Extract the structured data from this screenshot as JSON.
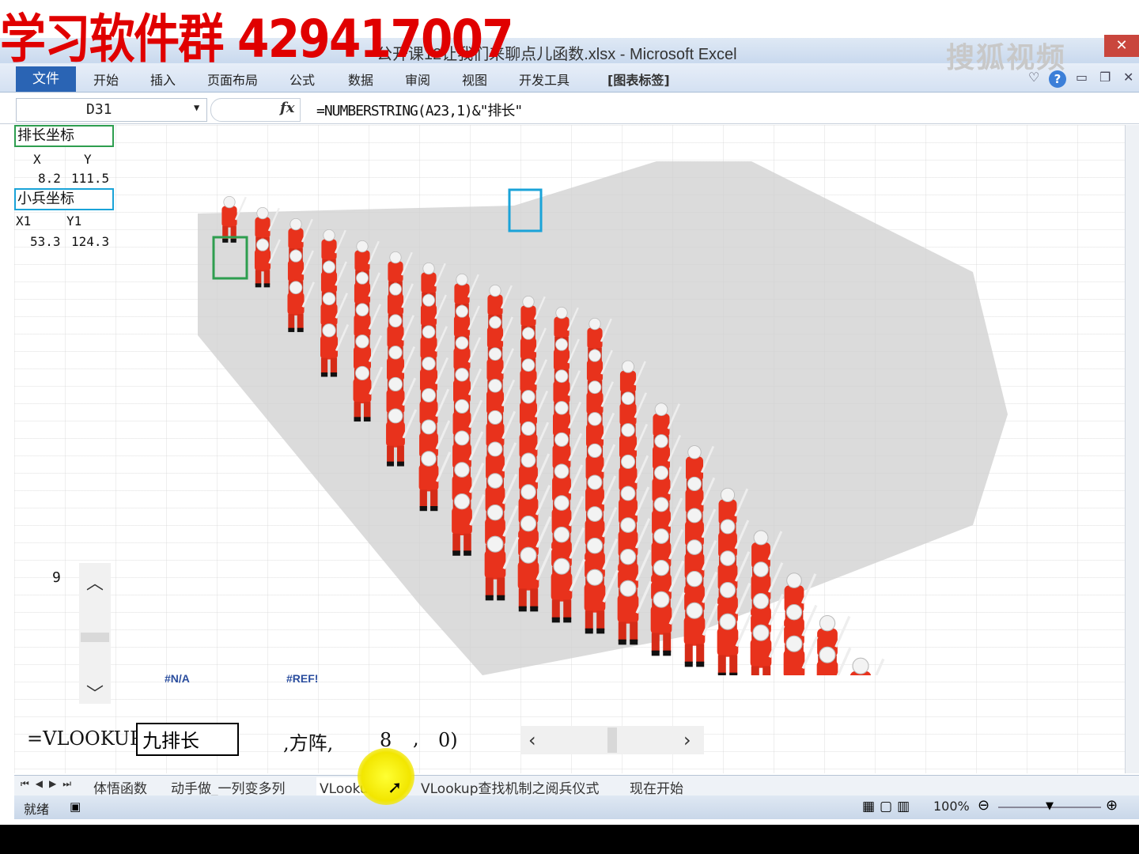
{
  "watermark": {
    "top_text": "学习软件群 429417007",
    "sohu": "搜狐视频"
  },
  "window": {
    "title": "公开课12让我们来聊点儿函数.xlsx - Microsoft Excel",
    "close": "✕"
  },
  "ribbon": {
    "file": "文件",
    "tabs": [
      "开始",
      "插入",
      "页面布局",
      "公式",
      "数据",
      "审阅",
      "视图",
      "开发工具"
    ],
    "context_tab": "[图表标签]"
  },
  "formula_bar": {
    "name_box": "D31",
    "fx": "fx",
    "formula": "=NUMBERSTRING(A23,1)&\"排长\""
  },
  "cells": {
    "platoon_label": "排长坐标",
    "x_header": "X",
    "y_header": "Y",
    "x_val": "8.2",
    "y_val": "111.5",
    "soldier_label": "小兵坐标",
    "x1_header": "X1",
    "y1_header": "Y1",
    "x1_val": "53.3",
    "y1_val": "124.3",
    "spinner_val": "9",
    "err_na": "#N/A",
    "err_ref": "#REF!"
  },
  "vlookup": {
    "prefix": "=VLOOKUP(",
    "input": "九排长",
    "mid": ",方阵,",
    "col": "8",
    "sep": ",",
    "end": "0)"
  },
  "sheet_tabs": [
    "体悟函数",
    "动手做_一列变多列",
    "VLookup函数",
    "VLookup查找机制之阅兵仪式",
    "现在开始"
  ],
  "status": {
    "ready": "就绪",
    "zoom": "100%"
  },
  "colors": {
    "accent": "#2a64b4",
    "watermark": "#e00000",
    "green_box": "#2e9e4f",
    "cyan_box": "#1aa3d8"
  }
}
